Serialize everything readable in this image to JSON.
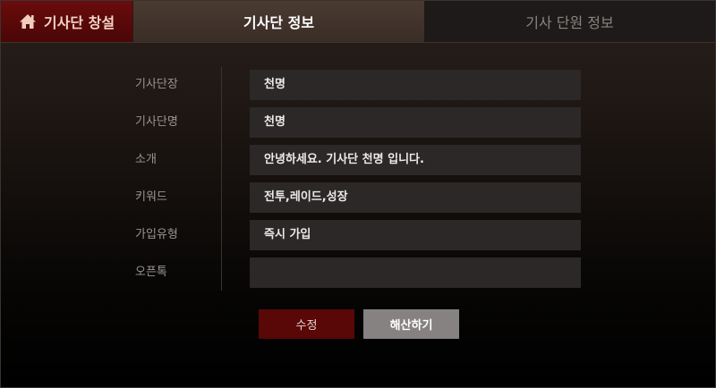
{
  "tabs": {
    "create": {
      "label": "기사단 창설",
      "icon": "home-icon"
    },
    "info": {
      "label": "기사단 정보"
    },
    "members": {
      "label": "기사 단원 정보"
    }
  },
  "form": {
    "rows": [
      {
        "label": "기사단장",
        "value": "천명"
      },
      {
        "label": "기사단명",
        "value": "천명"
      },
      {
        "label": "소개",
        "value": "안녕하세요. 기사단 천명 입니다."
      },
      {
        "label": "키워드",
        "value": "전투,레이드,성장"
      },
      {
        "label": "가입유형",
        "value": "즉시 가입"
      },
      {
        "label": "오픈톡",
        "value": ""
      }
    ]
  },
  "buttons": {
    "edit": "수정",
    "disband": "해산하기"
  },
  "colors": {
    "create_tab": "#5a0808",
    "active_tab": "#42342d",
    "inactive_tab": "#1d1a19",
    "field_bg": "#2b2827",
    "edit_button": "#5a0707",
    "disband_button": "#858281"
  }
}
